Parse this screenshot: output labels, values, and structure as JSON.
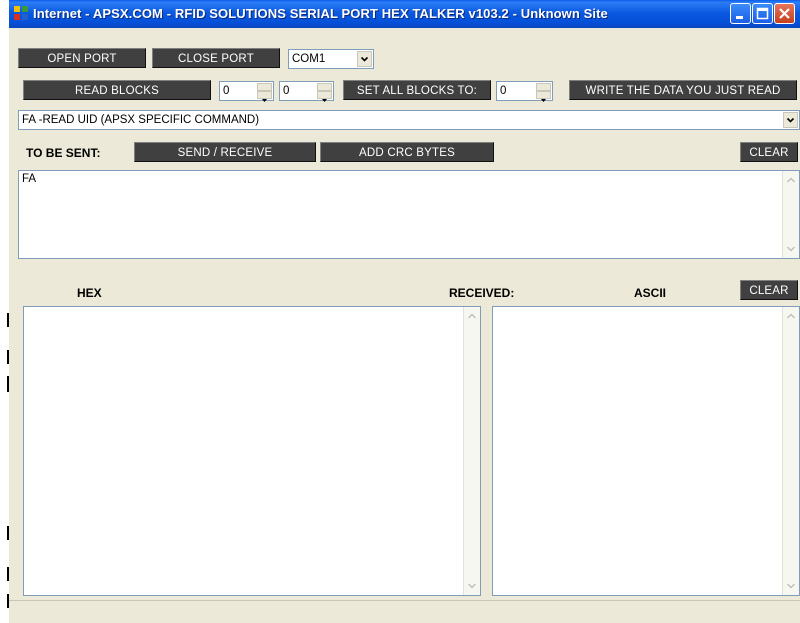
{
  "window": {
    "title": "Internet - APSX.COM - RFID SOLUTIONS SERIAL PORT HEX TALKER v103.2 - Unknown Site",
    "controls": [
      "minimize-icon",
      "maximize-icon",
      "close-icon"
    ]
  },
  "toolbar": {
    "open_port": "OPEN PORT",
    "close_port": "CLOSE PORT",
    "port_value": "COM1",
    "read_blocks": "READ BLOCKS",
    "block_from": "0",
    "block_to": "0",
    "set_all_blocks": "SET ALL BLOCKS TO:",
    "set_all_value": "0",
    "write_data": "WRITE THE DATA YOU JUST READ"
  },
  "command": {
    "selected": "FA -READ UID (APSX SPECIFIC COMMAND)"
  },
  "send": {
    "label": "TO BE SENT:",
    "send_receive": "SEND / RECEIVE",
    "add_crc": "ADD CRC BYTES",
    "clear": "CLEAR",
    "text": "FA"
  },
  "received": {
    "hex_label": "HEX",
    "received_label": "RECEIVED:",
    "ascii_label": "ASCII",
    "clear": "CLEAR",
    "hex_text": "",
    "ascii_text": ""
  },
  "colors": {
    "title_bar": "#0b59e0",
    "button_bg": "#404040",
    "button_text": "#ffffff",
    "window_bg": "#ece9d8"
  }
}
